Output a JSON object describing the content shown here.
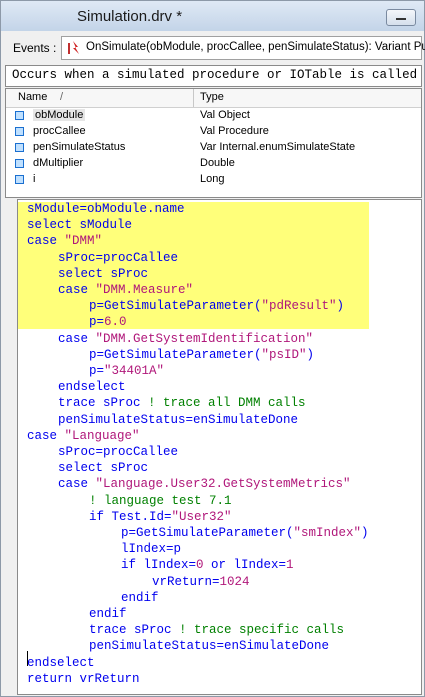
{
  "window": {
    "title": "Simulation.drv *"
  },
  "events": {
    "label": "Events :",
    "icon": "event-lightning-icon",
    "value": "OnSimulate(obModule, procCallee, penSimulateStatus): Variant Public"
  },
  "description": "Occurs when a simulated procedure or IOTable is called",
  "params": {
    "col_name": "Name",
    "col_sort": "/",
    "col_type": "Type",
    "rows": [
      {
        "name": "obModule",
        "type": "Val Object",
        "selected": true
      },
      {
        "name": "procCallee",
        "type": "Val Procedure"
      },
      {
        "name": "penSimulateStatus",
        "type": "Var Internal.enumSimulateState"
      },
      {
        "name": "dMultiplier",
        "type": "Double"
      },
      {
        "name": "i",
        "type": "Long"
      }
    ]
  },
  "code_lines": [
    {
      "indent": 0,
      "parts": [
        {
          "t": "sModule=obModule.name",
          "c": "kw"
        }
      ]
    },
    {
      "indent": 0,
      "parts": [
        {
          "t": "select sModule",
          "c": "kw"
        }
      ]
    },
    {
      "indent": 0,
      "parts": [
        {
          "t": "case ",
          "c": "kw"
        },
        {
          "t": "\"DMM\"",
          "c": "str"
        }
      ]
    },
    {
      "indent": 1,
      "parts": [
        {
          "t": "sProc=procCallee",
          "c": "kw"
        }
      ]
    },
    {
      "indent": 1,
      "parts": [
        {
          "t": "select sProc",
          "c": "kw"
        }
      ]
    },
    {
      "indent": 1,
      "parts": [
        {
          "t": "case ",
          "c": "kw"
        },
        {
          "t": "\"DMM.Measure\"",
          "c": "str"
        }
      ]
    },
    {
      "indent": 2,
      "parts": [
        {
          "t": "p=GetSimulateParameter(",
          "c": "kw"
        },
        {
          "t": "\"pdResult\"",
          "c": "str"
        },
        {
          "t": ")",
          "c": "kw"
        }
      ]
    },
    {
      "indent": 2,
      "parts": [
        {
          "t": "p=",
          "c": "kw"
        },
        {
          "t": "6.0",
          "c": "str"
        }
      ]
    },
    {
      "indent": 1,
      "parts": [
        {
          "t": "case ",
          "c": "kw"
        },
        {
          "t": "\"DMM.GetSystemIdentification\"",
          "c": "str"
        }
      ]
    },
    {
      "indent": 2,
      "parts": [
        {
          "t": "p=GetSimulateParameter(",
          "c": "kw"
        },
        {
          "t": "\"psID\"",
          "c": "str"
        },
        {
          "t": ")",
          "c": "kw"
        }
      ]
    },
    {
      "indent": 2,
      "parts": [
        {
          "t": "p=",
          "c": "kw"
        },
        {
          "t": "\"34401A\"",
          "c": "str"
        }
      ]
    },
    {
      "indent": 1,
      "parts": [
        {
          "t": "endselect",
          "c": "kw"
        }
      ]
    },
    {
      "indent": 1,
      "parts": [
        {
          "t": "trace sProc ",
          "c": "kw"
        },
        {
          "t": "! trace all DMM calls",
          "c": "cm"
        }
      ]
    },
    {
      "indent": 1,
      "parts": [
        {
          "t": "penSimulateStatus=enSimulateDone",
          "c": "kw"
        }
      ]
    },
    {
      "indent": 0,
      "parts": [
        {
          "t": "case ",
          "c": "kw"
        },
        {
          "t": "\"Language\"",
          "c": "str"
        }
      ]
    },
    {
      "indent": 1,
      "parts": [
        {
          "t": "sProc=procCallee",
          "c": "kw"
        }
      ]
    },
    {
      "indent": 1,
      "parts": [
        {
          "t": "select sProc",
          "c": "kw"
        }
      ]
    },
    {
      "indent": 1,
      "parts": [
        {
          "t": "case ",
          "c": "kw"
        },
        {
          "t": "\"Language.User32.GetSystemMetrics\"",
          "c": "str"
        }
      ]
    },
    {
      "indent": 2,
      "parts": [
        {
          "t": "! language test 7.1",
          "c": "cm"
        }
      ]
    },
    {
      "indent": 2,
      "parts": [
        {
          "t": "if Test.Id=",
          "c": "kw"
        },
        {
          "t": "\"User32\"",
          "c": "str"
        }
      ]
    },
    {
      "indent": 3,
      "parts": [
        {
          "t": "p=GetSimulateParameter(",
          "c": "kw"
        },
        {
          "t": "\"smIndex\"",
          "c": "str"
        },
        {
          "t": ")",
          "c": "kw"
        }
      ]
    },
    {
      "indent": 3,
      "parts": [
        {
          "t": "lIndex=p",
          "c": "kw"
        }
      ]
    },
    {
      "indent": 3,
      "parts": [
        {
          "t": "if lIndex=",
          "c": "kw"
        },
        {
          "t": "0",
          "c": "str"
        },
        {
          "t": " or lIndex=",
          "c": "kw"
        },
        {
          "t": "1",
          "c": "str"
        }
      ]
    },
    {
      "indent": 4,
      "parts": [
        {
          "t": "vrReturn=",
          "c": "kw"
        },
        {
          "t": "1024",
          "c": "str"
        }
      ]
    },
    {
      "indent": 3,
      "parts": [
        {
          "t": "endif",
          "c": "kw"
        }
      ]
    },
    {
      "indent": 2,
      "parts": [
        {
          "t": "endif",
          "c": "kw"
        }
      ]
    },
    {
      "indent": 2,
      "parts": [
        {
          "t": "trace sProc ",
          "c": "kw"
        },
        {
          "t": "! trace specific calls",
          "c": "cm"
        }
      ]
    },
    {
      "indent": 2,
      "parts": [
        {
          "t": "penSimulateStatus=enSimulateDone",
          "c": "kw"
        }
      ]
    },
    {
      "indent": 0,
      "parts": [
        {
          "t": "endselect",
          "c": "kw"
        }
      ]
    },
    {
      "indent": 0,
      "parts": [
        {
          "t": "return vrReturn",
          "c": "kw"
        }
      ]
    }
  ]
}
